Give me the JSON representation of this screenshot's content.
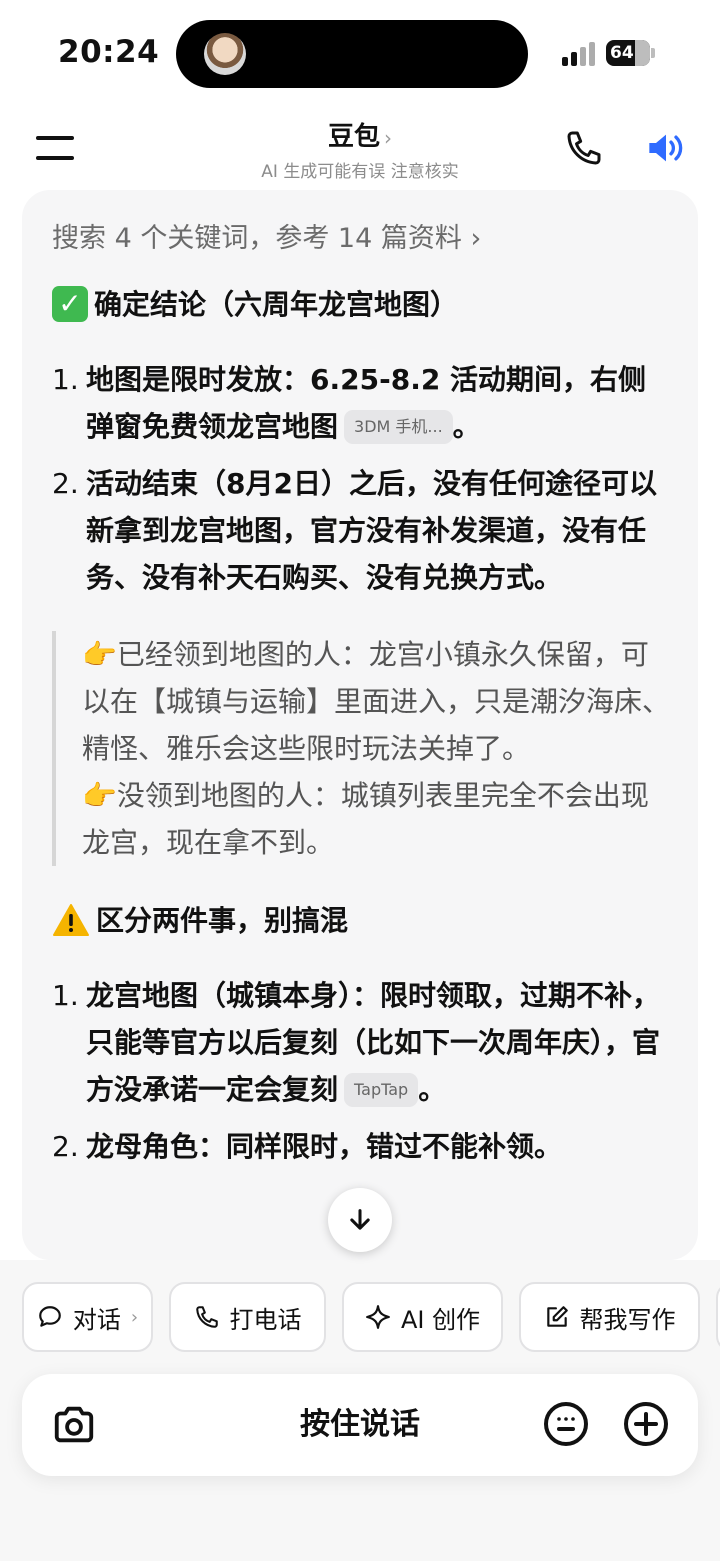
{
  "status_bar": {
    "time": "20:24",
    "battery": "64"
  },
  "header": {
    "title": "豆包",
    "title_chevron": "›",
    "subtitle": "AI 生成可能有误 注意核实"
  },
  "card": {
    "search_summary": "搜索 4 个关键词，参考 14 篇资料 ›",
    "section1_heading": "确定结论（六周年龙宫地图）",
    "list1": [
      {
        "num": "1.",
        "text": "地图是限时发放：6.25-8.2 活动期间，右侧弹窗免费领龙宫地图",
        "source": "3DM 手机...",
        "tail": "。"
      },
      {
        "num": "2.",
        "text": "活动结束（8月2日）之后，没有任何途径可以新拿到龙宫地图，官方没有补发渠道，没有任务、没有补天石购买、没有兑换方式。",
        "source": "",
        "tail": ""
      }
    ],
    "quote_line1_emoji": "👉",
    "quote_line1": "已经领到地图的人：龙宫小镇永久保留，可以在【城镇与运输】里面进入，只是潮汐海床、精怪、雅乐会这些限时玩法关掉了。",
    "quote_line2_emoji": "👉",
    "quote_line2": "没领到地图的人：城镇列表里完全不会出现龙宫，现在拿不到。",
    "section2_heading": "区分两件事，别搞混",
    "list2": [
      {
        "num": "1.",
        "text": "龙宫地图（城镇本身）：限时领取，过期不补，只能等官方以后复刻（比如下一次周年庆），官方没承诺一定会复刻",
        "source": "TapTap",
        "tail": "。"
      },
      {
        "num": "2.",
        "text": "龙母角色：同样限时，错过不能补领。",
        "source": "",
        "tail": ""
      }
    ]
  },
  "chips": [
    {
      "label": "对话",
      "icon": "chat-bubble-icon",
      "chevron": "›"
    },
    {
      "label": "打电话",
      "icon": "phone-icon"
    },
    {
      "label": "AI 创作",
      "icon": "sparkle-icon"
    },
    {
      "label": "帮我写作",
      "icon": "edit-icon"
    }
  ],
  "input_bar": {
    "hold_to_talk": "按住说话"
  },
  "colors": {
    "accent_blue": "#2f6bff",
    "card_bg": "#f6f6f7"
  }
}
